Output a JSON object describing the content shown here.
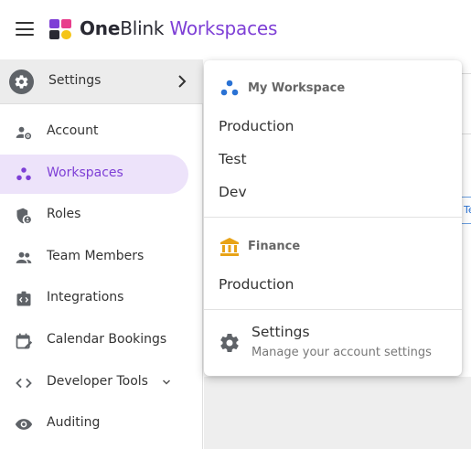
{
  "header": {
    "brand_bold": "One",
    "brand_rest": "Blink",
    "brand_accent": " Workspaces",
    "accent_color": "#7e3fd6"
  },
  "sidebar": {
    "settings_label": "Settings",
    "items": [
      {
        "label": "Account",
        "icon": "account-settings-icon",
        "active": false
      },
      {
        "label": "Workspaces",
        "icon": "workspaces-icon",
        "active": true
      },
      {
        "label": "Roles",
        "icon": "roles-shield-icon",
        "active": false
      },
      {
        "label": "Team Members",
        "icon": "team-members-icon",
        "active": false
      },
      {
        "label": "Integrations",
        "icon": "integrations-icon",
        "active": false
      },
      {
        "label": "Calendar Bookings",
        "icon": "calendar-icon",
        "active": false
      },
      {
        "label": "Developer Tools",
        "icon": "code-icon",
        "active": false,
        "expandable": true
      },
      {
        "label": "Auditing",
        "icon": "eye-icon",
        "active": false
      }
    ]
  },
  "menu": {
    "sections": [
      {
        "title": "My Workspace",
        "icon": "workspace-dots-icon",
        "items": [
          "Production",
          "Test",
          "Dev"
        ]
      },
      {
        "title": "Finance",
        "icon": "bank-icon",
        "icon_color": "#e8a317",
        "items": [
          "Production"
        ]
      }
    ],
    "settings": {
      "title": "Settings",
      "subtitle": "Manage your account settings"
    }
  },
  "background": {
    "tab_peek_text": "Te"
  }
}
